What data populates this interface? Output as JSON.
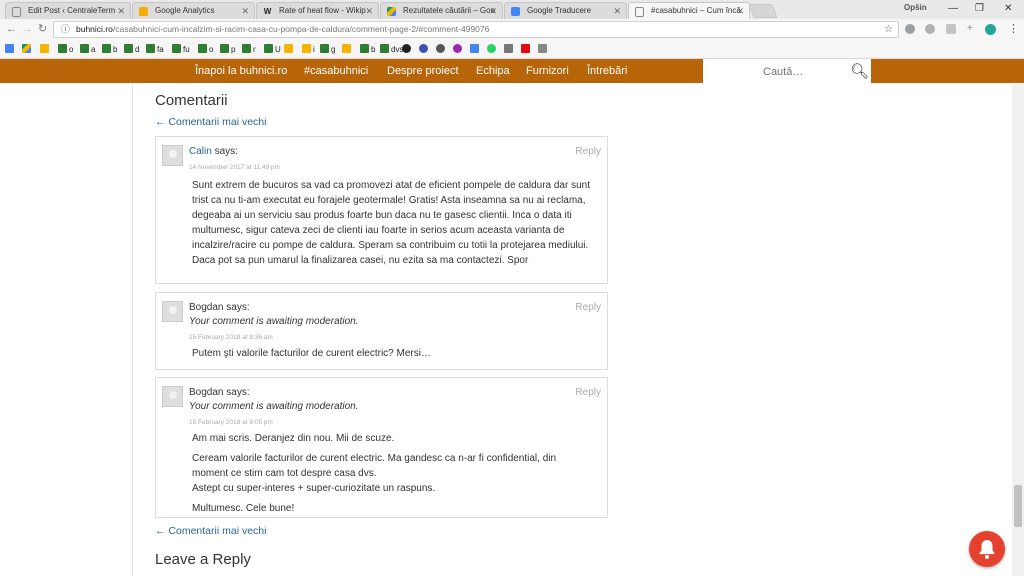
{
  "browser": {
    "tabs": [
      {
        "title": "Edit Post ‹ CentraleTerm",
        "fav": "doc",
        "active": false
      },
      {
        "title": "Google Analytics",
        "fav": "ga",
        "active": false
      },
      {
        "title": "Rate of heat flow - Wikip",
        "fav": "w",
        "active": false
      },
      {
        "title": "Rezultatele căutării – Goo",
        "fav": "drive",
        "active": false
      },
      {
        "title": "Google Traducere",
        "fav": "gt",
        "active": false
      },
      {
        "title": "#casabuhnici – Cum încă",
        "fav": "doc",
        "active": true
      }
    ],
    "profile": "Opšin",
    "url_host": "buhnici.ro",
    "url_path": "/casabuhnici-cum-incalzim-si-racim-casa-cu-pompa-de-caldura/comment-page-2/#comment-499076",
    "bookmarks": [
      "o",
      "a",
      "b",
      "d",
      "fa",
      "fu",
      "o",
      "p",
      "r",
      "U",
      "i",
      "g",
      "b",
      "dvs"
    ]
  },
  "site_nav": {
    "items": [
      "Înapoi la buhnici.ro",
      "#casabuhnici",
      "Despre proiect",
      "Echipa",
      "Furnizori",
      "Întrebări"
    ],
    "search_placeholder": "Caută…",
    "colors": {
      "bar": "#b8650a",
      "link": "#2a6496",
      "notification": "#e5412f"
    }
  },
  "comments_section": {
    "title": "Comentarii",
    "older_link": "← Comentarii mai vechi",
    "says": "says:",
    "reply_label": "Reply",
    "moderation_note": "Your comment is awaiting moderation.",
    "comments": [
      {
        "author": "Calin",
        "date": "14 November 2017 at 11:49 pm",
        "paragraphs": [
          "Sunt extrem de bucuros sa vad ca promovezi atat de eficient pompele de caldura dar sunt trist ca nu ti-am executat eu forajele geotermale! Gratis! Asta inseamna sa nu ai reclama, degeaba ai un serviciu sau produs foarte bun daca nu te gasesc clientii. Inca o data iti multumesc, sigur cateva zeci de clienti iau foarte in serios acum aceasta varianta de incalzire/racire cu pompe de caldura. Speram sa contribuim cu totii la protejarea mediului. Daca pot sa pun umarul la finalizarea casei, nu ezita sa ma contactezi. Spor"
        ]
      },
      {
        "author": "Bogdan",
        "date": "15 February 2018 at 8:36 am",
        "paragraphs": [
          "Putem şti valorile facturilor de curent electric? Mersi…"
        ]
      },
      {
        "author": "Bogdan",
        "date": "15 February 2018 at 8:05 pm",
        "paragraphs": [
          "Am mai scris. Deranjez din nou. Mii de scuze.",
          "Ceream valorile facturilor de curent electric. Ma gandesc ca n-ar fi confidential, din moment ce stim cam tot despre casa dvs.",
          "Astept cu super-interes + super-curiozitate un raspuns.",
          "Multumesc. Cele bune!"
        ]
      }
    ],
    "older_link_bottom": "← Comentarii mai vechi",
    "leave_reply": "Leave a Reply"
  }
}
